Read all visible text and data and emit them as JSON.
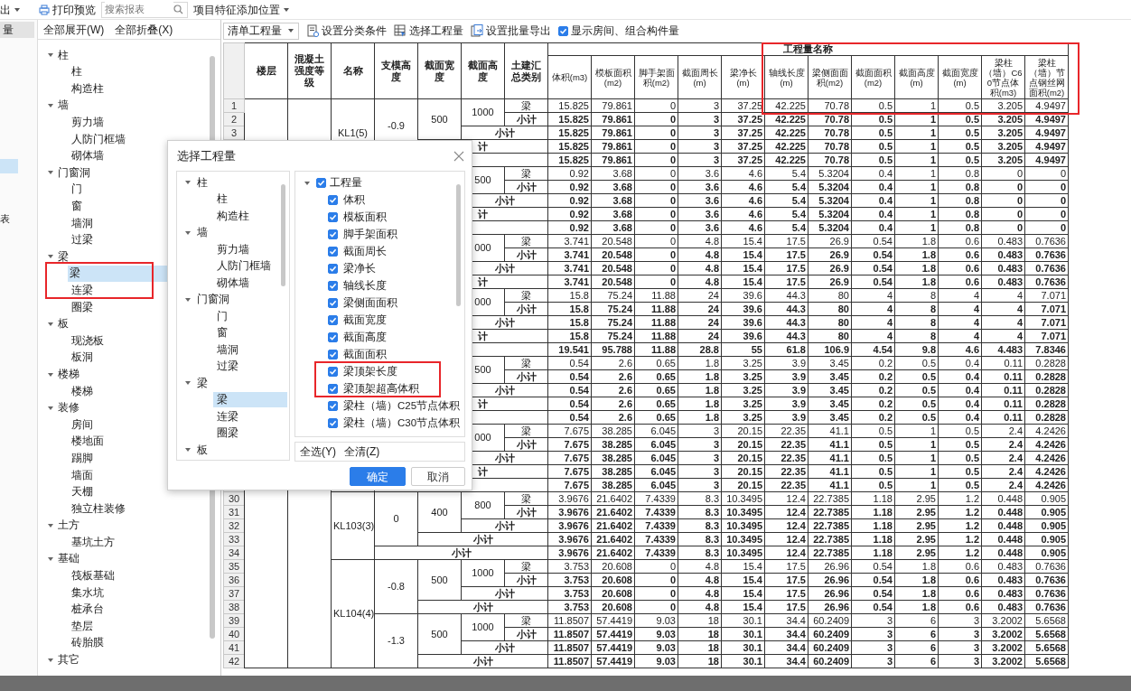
{
  "toolbar": {
    "export_menu": "出",
    "print_preview": "打印预览",
    "search": {
      "placeholder": "搜索报表"
    },
    "feature_position": "项目特征添加位置"
  },
  "side_tabs": [
    {
      "label": "量",
      "selected": true
    }
  ],
  "side_items": [
    {
      "selected": true
    },
    {
      "label": "表",
      "selected": false
    }
  ],
  "tree_actions": [
    "全部展开(W)",
    "全部折叠(X)"
  ],
  "tree": [
    {
      "label": "柱",
      "expanded": true,
      "children": [
        {
          "label": "柱",
          "selected": false
        },
        {
          "label": "构造柱",
          "selected": false
        }
      ]
    },
    {
      "label": "墙",
      "expanded": true,
      "children": [
        {
          "label": "剪力墙",
          "selected": false
        },
        {
          "label": "人防门框墙",
          "selected": false
        },
        {
          "label": "砌体墙",
          "selected": false
        }
      ]
    },
    {
      "label": "门窗洞",
      "expanded": true,
      "children": [
        {
          "label": "门",
          "selected": false
        },
        {
          "label": "窗",
          "selected": false
        },
        {
          "label": "墙洞",
          "selected": false
        },
        {
          "label": "过梁",
          "selected": false
        }
      ]
    },
    {
      "label": "梁",
      "expanded": true,
      "children": [
        {
          "label": "梁",
          "selected": true
        },
        {
          "label": "连梁",
          "selected": false
        },
        {
          "label": "圈梁",
          "selected": false
        }
      ]
    },
    {
      "label": "板",
      "expanded": true,
      "children": [
        {
          "label": "现浇板",
          "selected": false
        },
        {
          "label": "板洞",
          "selected": false
        }
      ]
    },
    {
      "label": "楼梯",
      "expanded": true,
      "children": [
        {
          "label": "楼梯",
          "selected": false
        }
      ]
    },
    {
      "label": "装修",
      "expanded": true,
      "children": [
        {
          "label": "房间",
          "selected": false
        },
        {
          "label": "楼地面",
          "selected": false
        },
        {
          "label": "踢脚",
          "selected": false
        },
        {
          "label": "墙面",
          "selected": false
        },
        {
          "label": "天棚",
          "selected": false
        },
        {
          "label": "独立柱装修",
          "selected": false
        }
      ]
    },
    {
      "label": "土方",
      "expanded": true,
      "children": [
        {
          "label": "基坑土方",
          "selected": false
        }
      ]
    },
    {
      "label": "基础",
      "expanded": true,
      "children": [
        {
          "label": "筏板基础",
          "selected": false
        },
        {
          "label": "集水坑",
          "selected": false
        },
        {
          "label": "桩承台",
          "selected": false
        },
        {
          "label": "垫层",
          "selected": false
        },
        {
          "label": "砖胎膜",
          "selected": false
        }
      ]
    },
    {
      "label": "其它",
      "expanded": true
    }
  ],
  "report_toolbar": {
    "type_select": "清单工程量",
    "actions": [
      "设置分类条件",
      "选择工程量",
      "设置批量导出"
    ],
    "show_rooms": {
      "label": "显示房间、组合构件量",
      "checked": true
    }
  },
  "table": {
    "columns": [
      "楼层",
      "混凝土强度等级",
      "名称",
      "支模高度",
      "截面宽度",
      "截面高度",
      "土建汇总类别"
    ],
    "group_header": "工程量名称",
    "quantity_columns": [
      "体积(m3)",
      "模板面积(m2)",
      "脚手架面积(m2)",
      "截面周长(m)",
      "梁净长(m)",
      "轴线长度(m)",
      "梁侧面面积(m2)",
      "截面面积(m2)",
      "截面高度(m)",
      "截面宽度(m)",
      "梁柱（墙）C60节点体积(m3)",
      "梁柱（墙）节点钢丝网面积(m2)"
    ],
    "names": [
      {
        "name": "KL1(5)",
        "supports": [
          {
            "value": "-0.9",
            "widths": [
              {
                "value": "500",
                "heights": [
                  {
                    "value": "1000",
                    "rows": [
                      {
                        "num": "1",
                        "kind": "item",
                        "category": "梁",
                        "values": [
                          "15.825",
                          "79.861",
                          "0",
                          "3",
                          "37.25",
                          "42.225",
                          "70.78",
                          "0.5",
                          "1",
                          "0.5",
                          "3.205",
                          "4.9497"
                        ]
                      },
                      {
                        "num": "2",
                        "kind": "subtotal",
                        "category": "小计",
                        "values": [
                          "15.825",
                          "79.861",
                          "0",
                          "3",
                          "37.25",
                          "42.225",
                          "70.78",
                          "0.5",
                          "1",
                          "0.5",
                          "3.205",
                          "4.9497"
                        ]
                      }
                    ],
                    "total": {
                      "num": "3",
                      "label": "小计",
                      "values": [
                        "15.825",
                        "79.861",
                        "0",
                        "3",
                        "37.25",
                        "42.225",
                        "70.78",
                        "0.5",
                        "1",
                        "0.5",
                        "3.205",
                        "4.9497"
                      ]
                    }
                  }
                ],
                "total": {
                  "label": "计",
                  "values": [
                    "15.825",
                    "79.861",
                    "0",
                    "3",
                    "37.25",
                    "42.225",
                    "70.78",
                    "0.5",
                    "1",
                    "0.5",
                    "3.205",
                    "4.9497"
                  ]
                }
              }
            ],
            "total": {
              "values": [
                "15.825",
                "79.861",
                "0",
                "3",
                "37.25",
                "42.225",
                "70.78",
                "0.5",
                "1",
                "0.5",
                "3.205",
                "4.9497"
              ]
            }
          }
        ]
      },
      {
        "supports": [
          {
            "widths": [
              {
                "heights": [
                  {
                    "value": "500",
                    "rows": [
                      {
                        "kind": "item",
                        "category": "梁",
                        "values": [
                          "0.92",
                          "3.68",
                          "0",
                          "3.6",
                          "4.6",
                          "5.4",
                          "5.3204",
                          "0.4",
                          "1",
                          "0.8",
                          "0",
                          "0"
                        ]
                      },
                      {
                        "kind": "subtotal",
                        "category": "小计",
                        "values": [
                          "0.92",
                          "3.68",
                          "0",
                          "3.6",
                          "4.6",
                          "5.4",
                          "5.3204",
                          "0.4",
                          "1",
                          "0.8",
                          "0",
                          "0"
                        ]
                      }
                    ],
                    "total": {
                      "label": "小计",
                      "values": [
                        "0.92",
                        "3.68",
                        "0",
                        "3.6",
                        "4.6",
                        "5.4",
                        "5.3204",
                        "0.4",
                        "1",
                        "0.8",
                        "0",
                        "0"
                      ]
                    }
                  }
                ],
                "total": {
                  "label": "计",
                  "values": [
                    "0.92",
                    "3.68",
                    "0",
                    "3.6",
                    "4.6",
                    "5.4",
                    "5.3204",
                    "0.4",
                    "1",
                    "0.8",
                    "0",
                    "0"
                  ]
                }
              }
            ],
            "total": {
              "values": [
                "0.92",
                "3.68",
                "0",
                "3.6",
                "4.6",
                "5.4",
                "5.3204",
                "0.4",
                "1",
                "0.8",
                "0",
                "0"
              ]
            }
          },
          {
            "widths": [
              {
                "heights": [
                  {
                    "value": "000",
                    "rows": [
                      {
                        "kind": "item",
                        "category": "梁",
                        "values": [
                          "3.741",
                          "20.548",
                          "0",
                          "4.8",
                          "15.4",
                          "17.5",
                          "26.9",
                          "0.54",
                          "1.8",
                          "0.6",
                          "0.483",
                          "0.7636"
                        ]
                      },
                      {
                        "kind": "subtotal",
                        "category": "小计",
                        "values": [
                          "3.741",
                          "20.548",
                          "0",
                          "4.8",
                          "15.4",
                          "17.5",
                          "26.9",
                          "0.54",
                          "1.8",
                          "0.6",
                          "0.483",
                          "0.7636"
                        ]
                      }
                    ],
                    "total": {
                      "label": "小计",
                      "values": [
                        "3.741",
                        "20.548",
                        "0",
                        "4.8",
                        "15.4",
                        "17.5",
                        "26.9",
                        "0.54",
                        "1.8",
                        "0.6",
                        "0.483",
                        "0.7636"
                      ]
                    }
                  }
                ],
                "total": {
                  "label": "计",
                  "values": [
                    "3.741",
                    "20.548",
                    "0",
                    "4.8",
                    "15.4",
                    "17.5",
                    "26.9",
                    "0.54",
                    "1.8",
                    "0.6",
                    "0.483",
                    "0.7636"
                  ]
                }
              },
              {
                "heights": [
                  {
                    "value": "000",
                    "rows": [
                      {
                        "kind": "item",
                        "category": "梁",
                        "values": [
                          "15.8",
                          "75.24",
                          "11.88",
                          "24",
                          "39.6",
                          "44.3",
                          "80",
                          "4",
                          "8",
                          "4",
                          "4",
                          "7.071"
                        ]
                      },
                      {
                        "kind": "subtotal",
                        "category": "小计",
                        "values": [
                          "15.8",
                          "75.24",
                          "11.88",
                          "24",
                          "39.6",
                          "44.3",
                          "80",
                          "4",
                          "8",
                          "4",
                          "4",
                          "7.071"
                        ]
                      }
                    ],
                    "total": {
                      "label": "小计",
                      "values": [
                        "15.8",
                        "75.24",
                        "11.88",
                        "24",
                        "39.6",
                        "44.3",
                        "80",
                        "4",
                        "8",
                        "4",
                        "4",
                        "7.071"
                      ]
                    }
                  }
                ],
                "total": {
                  "label": "计",
                  "values": [
                    "15.8",
                    "75.24",
                    "11.88",
                    "24",
                    "39.6",
                    "44.3",
                    "80",
                    "4",
                    "8",
                    "4",
                    "4",
                    "7.071"
                  ]
                }
              }
            ],
            "total": {
              "values": [
                "19.541",
                "95.788",
                "11.88",
                "28.8",
                "55",
                "61.8",
                "106.9",
                "4.54",
                "9.8",
                "4.6",
                "4.483",
                "7.8346"
              ]
            }
          },
          {
            "widths": [
              {
                "heights": [
                  {
                    "value": "500",
                    "rows": [
                      {
                        "kind": "item",
                        "category": "梁",
                        "values": [
                          "0.54",
                          "2.6",
                          "0.65",
                          "1.8",
                          "3.25",
                          "3.9",
                          "3.45",
                          "0.2",
                          "0.5",
                          "0.4",
                          "0.11",
                          "0.2828"
                        ]
                      },
                      {
                        "kind": "subtotal",
                        "category": "小计",
                        "values": [
                          "0.54",
                          "2.6",
                          "0.65",
                          "1.8",
                          "3.25",
                          "3.9",
                          "3.45",
                          "0.2",
                          "0.5",
                          "0.4",
                          "0.11",
                          "0.2828"
                        ]
                      }
                    ],
                    "total": {
                      "label": "小计",
                      "values": [
                        "0.54",
                        "2.6",
                        "0.65",
                        "1.8",
                        "3.25",
                        "3.9",
                        "3.45",
                        "0.2",
                        "0.5",
                        "0.4",
                        "0.11",
                        "0.2828"
                      ]
                    }
                  }
                ],
                "total": {
                  "label": "计",
                  "values": [
                    "0.54",
                    "2.6",
                    "0.65",
                    "1.8",
                    "3.25",
                    "3.9",
                    "3.45",
                    "0.2",
                    "0.5",
                    "0.4",
                    "0.11",
                    "0.2828"
                  ]
                }
              }
            ],
            "total": {
              "values": [
                "0.54",
                "2.6",
                "0.65",
                "1.8",
                "3.25",
                "3.9",
                "3.45",
                "0.2",
                "0.5",
                "0.4",
                "0.11",
                "0.2828"
              ]
            }
          },
          {
            "widths": [
              {
                "heights": [
                  {
                    "value": "000",
                    "rows": [
                      {
                        "kind": "item",
                        "category": "梁",
                        "values": [
                          "7.675",
                          "38.285",
                          "6.045",
                          "3",
                          "20.15",
                          "22.35",
                          "41.1",
                          "0.5",
                          "1",
                          "0.5",
                          "2.4",
                          "4.2426"
                        ]
                      },
                      {
                        "kind": "subtotal",
                        "category": "小计",
                        "values": [
                          "7.675",
                          "38.285",
                          "6.045",
                          "3",
                          "20.15",
                          "22.35",
                          "41.1",
                          "0.5",
                          "1",
                          "0.5",
                          "2.4",
                          "4.2426"
                        ]
                      }
                    ],
                    "total": {
                      "label": "小计",
                      "values": [
                        "7.675",
                        "38.285",
                        "6.045",
                        "3",
                        "20.15",
                        "22.35",
                        "41.1",
                        "0.5",
                        "1",
                        "0.5",
                        "2.4",
                        "4.2426"
                      ]
                    }
                  }
                ],
                "total": {
                  "label": "计",
                  "values": [
                    "7.675",
                    "38.285",
                    "6.045",
                    "3",
                    "20.15",
                    "22.35",
                    "41.1",
                    "0.5",
                    "1",
                    "0.5",
                    "2.4",
                    "4.2426"
                  ]
                }
              }
            ],
            "total": {
              "values": [
                "7.675",
                "38.285",
                "6.045",
                "3",
                "20.15",
                "22.35",
                "41.1",
                "0.5",
                "1",
                "0.5",
                "2.4",
                "4.2426"
              ]
            }
          }
        ]
      },
      {
        "name": "KL103(3)",
        "supports": [
          {
            "value": "0",
            "widths": [
              {
                "value": "400",
                "heights": [
                  {
                    "value": "800",
                    "rows": [
                      {
                        "num": "30",
                        "kind": "item",
                        "category": "梁",
                        "values": [
                          "3.9676",
                          "21.6402",
                          "7.4339",
                          "8.3",
                          "10.3495",
                          "12.4",
                          "22.7385",
                          "1.18",
                          "2.95",
                          "1.2",
                          "0.448",
                          "0.905"
                        ]
                      },
                      {
                        "num": "31",
                        "kind": "subtotal",
                        "category": "小计",
                        "values": [
                          "3.9676",
                          "21.6402",
                          "7.4339",
                          "8.3",
                          "10.3495",
                          "12.4",
                          "22.7385",
                          "1.18",
                          "2.95",
                          "1.2",
                          "0.448",
                          "0.905"
                        ]
                      }
                    ],
                    "total": {
                      "num": "32",
                      "label": "小计",
                      "values": [
                        "3.9676",
                        "21.6402",
                        "7.4339",
                        "8.3",
                        "10.3495",
                        "12.4",
                        "22.7385",
                        "1.18",
                        "2.95",
                        "1.2",
                        "0.448",
                        "0.905"
                      ]
                    }
                  }
                ],
                "total": {
                  "num": "33",
                  "label": "小计",
                  "values": [
                    "3.9676",
                    "21.6402",
                    "7.4339",
                    "8.3",
                    "10.3495",
                    "12.4",
                    "22.7385",
                    "1.18",
                    "2.95",
                    "1.2",
                    "0.448",
                    "0.905"
                  ]
                }
              }
            ],
            "total": {
              "num": "34",
              "label": "小计",
              "values": [
                "3.9676",
                "21.6402",
                "7.4339",
                "8.3",
                "10.3495",
                "12.4",
                "22.7385",
                "1.18",
                "2.95",
                "1.2",
                "0.448",
                "0.905"
              ]
            }
          }
        ]
      },
      {
        "name": "KL104(4)",
        "supports": [
          {
            "value": "-0.8",
            "widths": [
              {
                "value": "500",
                "heights": [
                  {
                    "value": "1000",
                    "rows": [
                      {
                        "num": "35",
                        "kind": "item",
                        "category": "梁",
                        "values": [
                          "3.753",
                          "20.608",
                          "0",
                          "4.8",
                          "15.4",
                          "17.5",
                          "26.96",
                          "0.54",
                          "1.8",
                          "0.6",
                          "0.483",
                          "0.7636"
                        ]
                      },
                      {
                        "num": "36",
                        "kind": "subtotal",
                        "category": "小计",
                        "values": [
                          "3.753",
                          "20.608",
                          "0",
                          "4.8",
                          "15.4",
                          "17.5",
                          "26.96",
                          "0.54",
                          "1.8",
                          "0.6",
                          "0.483",
                          "0.7636"
                        ]
                      }
                    ],
                    "total": {
                      "num": "37",
                      "label": "小计",
                      "values": [
                        "3.753",
                        "20.608",
                        "0",
                        "4.8",
                        "15.4",
                        "17.5",
                        "26.96",
                        "0.54",
                        "1.8",
                        "0.6",
                        "0.483",
                        "0.7636"
                      ]
                    }
                  }
                ],
                "total": {
                  "num": "38",
                  "label": "小计",
                  "values": [
                    "3.753",
                    "20.608",
                    "0",
                    "4.8",
                    "15.4",
                    "17.5",
                    "26.96",
                    "0.54",
                    "1.8",
                    "0.6",
                    "0.483",
                    "0.7636"
                  ]
                }
              }
            ]
          },
          {
            "value": "-1.3",
            "widths": [
              {
                "value": "500",
                "heights": [
                  {
                    "value": "1000",
                    "rows": [
                      {
                        "num": "39",
                        "kind": "item",
                        "category": "梁",
                        "values": [
                          "11.8507",
                          "57.4419",
                          "9.03",
                          "18",
                          "30.1",
                          "34.4",
                          "60.2409",
                          "3",
                          "6",
                          "3",
                          "3.2002",
                          "5.6568"
                        ]
                      },
                      {
                        "num": "40",
                        "kind": "subtotal",
                        "category": "小计",
                        "values": [
                          "11.8507",
                          "57.4419",
                          "9.03",
                          "18",
                          "30.1",
                          "34.4",
                          "60.2409",
                          "3",
                          "6",
                          "3",
                          "3.2002",
                          "5.6568"
                        ]
                      }
                    ],
                    "total": {
                      "num": "41",
                      "label": "小计",
                      "values": [
                        "11.8507",
                        "57.4419",
                        "9.03",
                        "18",
                        "30.1",
                        "34.4",
                        "60.2409",
                        "3",
                        "6",
                        "3",
                        "3.2002",
                        "5.6568"
                      ]
                    }
                  }
                ],
                "total": {
                  "num": "42",
                  "label": "小计",
                  "values": [
                    "11.8507",
                    "57.4419",
                    "9.03",
                    "18",
                    "30.1",
                    "34.4",
                    "60.2409",
                    "3",
                    "6",
                    "3",
                    "3.2002",
                    "5.6568"
                  ]
                }
              }
            ]
          }
        ]
      }
    ]
  },
  "dialog": {
    "title": "选择工程量",
    "tree": [
      {
        "label": "柱",
        "expanded": true,
        "children": [
          {
            "label": "柱",
            "selected": false
          },
          {
            "label": "构造柱",
            "selected": false
          }
        ]
      },
      {
        "label": "墙",
        "expanded": true,
        "children": [
          {
            "label": "剪力墙",
            "selected": false
          },
          {
            "label": "人防门框墙",
            "selected": false
          },
          {
            "label": "砌体墙",
            "selected": false
          }
        ]
      },
      {
        "label": "门窗洞",
        "expanded": true,
        "children": [
          {
            "label": "门",
            "selected": false
          },
          {
            "label": "窗",
            "selected": false
          },
          {
            "label": "墙洞",
            "selected": false
          },
          {
            "label": "过梁",
            "selected": false
          }
        ]
      },
      {
        "label": "梁",
        "expanded": true,
        "children": [
          {
            "label": "梁",
            "selected": true
          },
          {
            "label": "连梁",
            "selected": false
          },
          {
            "label": "圈梁",
            "selected": false
          }
        ]
      },
      {
        "label": "板",
        "expanded": true
      }
    ],
    "quantities": {
      "label": "工程量",
      "checked": true,
      "expanded": true,
      "children": [
        {
          "label": "体积",
          "checked": true
        },
        {
          "label": "模板面积",
          "checked": true
        },
        {
          "label": "脚手架面积",
          "checked": true
        },
        {
          "label": "截面周长",
          "checked": true
        },
        {
          "label": "梁净长",
          "checked": true
        },
        {
          "label": "轴线长度",
          "checked": true
        },
        {
          "label": "梁侧面面积",
          "checked": true
        },
        {
          "label": "截面宽度",
          "checked": true
        },
        {
          "label": "截面高度",
          "checked": true
        },
        {
          "label": "截面面积",
          "checked": true
        },
        {
          "label": "梁顶架长度",
          "checked": true
        },
        {
          "label": "梁顶架超高体积",
          "checked": true
        },
        {
          "label": "梁柱（墙）C25节点体积",
          "checked": true
        },
        {
          "label": "梁柱（墙）C30节点体积",
          "checked": true
        }
      ]
    },
    "links": [
      "全选(Y)",
      "全清(Z)"
    ],
    "buttons": [
      {
        "label": "确定",
        "kind": "primary"
      },
      {
        "label": "取消",
        "kind": "secondary"
      }
    ]
  }
}
